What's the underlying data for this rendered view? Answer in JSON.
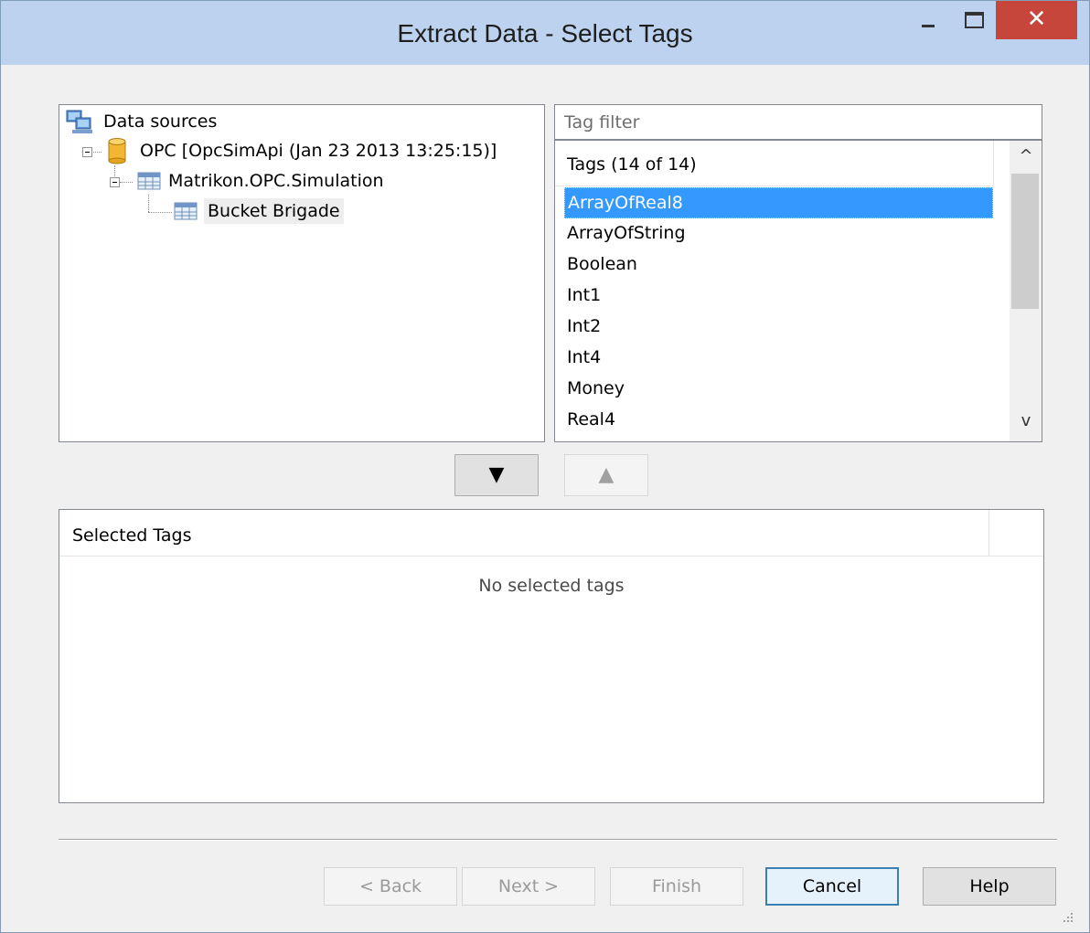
{
  "window": {
    "title": "Extract Data - Select Tags",
    "minimize_glyph": "—",
    "maximize_glyph": "□",
    "close_glyph": "✕"
  },
  "tree": {
    "root": {
      "label": "Data sources",
      "icon": "data-sources-icon"
    },
    "opc": {
      "label": "OPC [OpcSimApi (Jan 23 2013 13:25:15)]",
      "icon": "database-icon"
    },
    "server": {
      "label": "Matrikon.OPC.Simulation",
      "icon": "table-icon"
    },
    "group": {
      "label": "Bucket Brigade",
      "icon": "table-icon",
      "selected": true
    }
  },
  "tag_filter": {
    "placeholder": "Tag filter",
    "value": ""
  },
  "tags": {
    "header": "Tags (14 of 14)",
    "items": [
      "ArrayOfReal8",
      "ArrayOfString",
      "Boolean",
      "Int1",
      "Int2",
      "Int4",
      "Money",
      "Real4"
    ],
    "selected_index": 0,
    "scroll_up": "^",
    "scroll_down": "v"
  },
  "move_buttons": {
    "add_glyph": "▼",
    "remove_glyph": "▲"
  },
  "selected_tags": {
    "header": "Selected Tags",
    "empty_message": "No selected tags"
  },
  "buttons": {
    "back": "< Back",
    "next": "Next >",
    "finish": "Finish",
    "cancel": "Cancel",
    "help": "Help"
  },
  "colors": {
    "titlebar": "#bcd2ee",
    "close": "#c7463b",
    "selection": "#3399ff"
  }
}
